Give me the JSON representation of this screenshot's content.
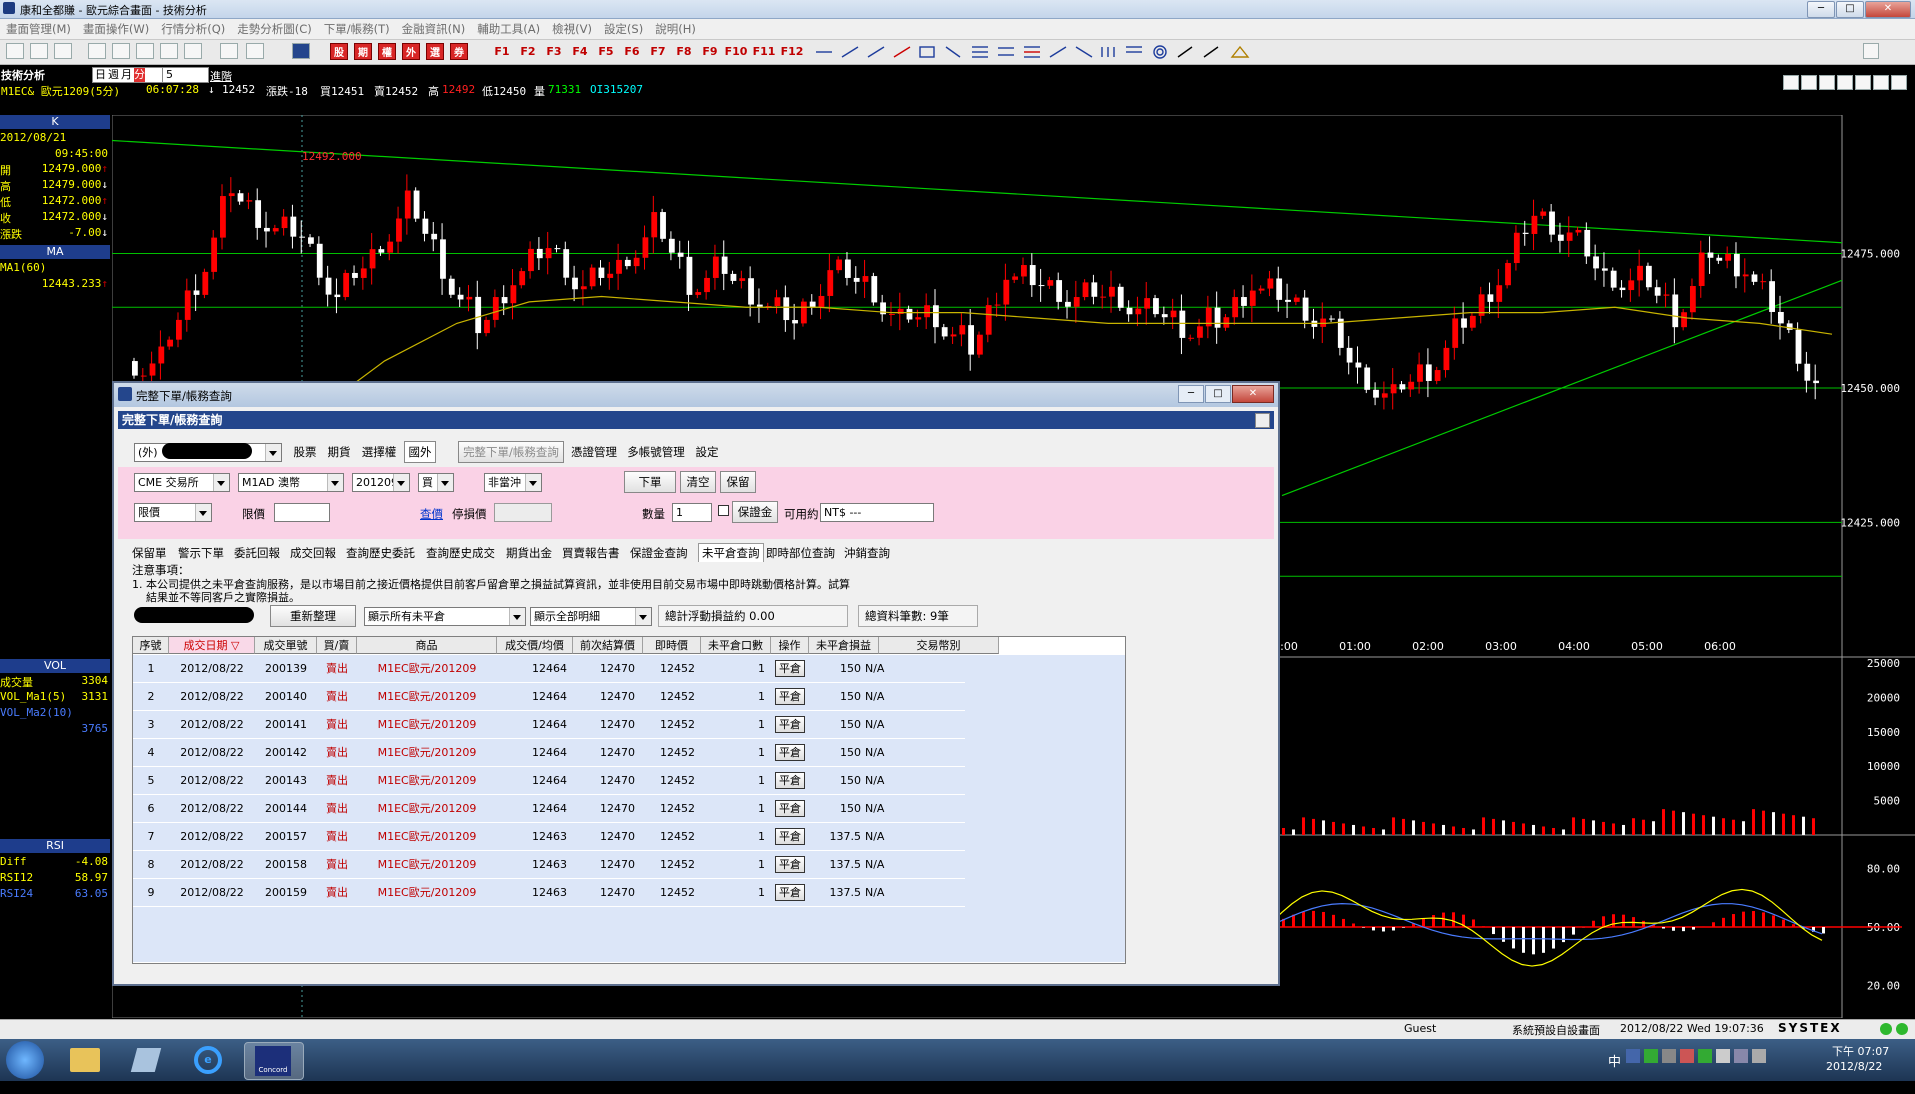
{
  "window": {
    "title": "康和全都賺 - 歐元綜合畫面 - 技術分析",
    "min": "─",
    "max": "□",
    "close": "✕"
  },
  "menu": [
    "畫面管理(M)",
    "畫面操作(W)",
    "行情分析(Q)",
    "走勢分析圖(C)",
    "下單/帳務(T)",
    "金融資訊(N)",
    "輔助工具(A)",
    "檢視(V)",
    "設定(S)",
    "說明(H)"
  ],
  "toolbar": {
    "red_buttons": [
      "股",
      "期",
      "權",
      "外",
      "選",
      "券"
    ],
    "fkeys": [
      "F1",
      "F2",
      "F3",
      "F4",
      "F5",
      "F6",
      "F7",
      "F8",
      "F9",
      "F10",
      "F11",
      "F12"
    ]
  },
  "chart_header": {
    "section": "技術分析",
    "period_options": [
      "日",
      "週",
      "月",
      "分"
    ],
    "period_selected": "分",
    "interval": "5",
    "advanced": "進階",
    "symbol": "M1EC& 歐元1209(5分)",
    "time": "06:07:28",
    "arrow": "↓",
    "last": "12452",
    "change": "漲跌-18",
    "bid": "買12451",
    "ask": "賣12452",
    "high_label": "高",
    "high": "12492",
    "low": "低12450",
    "volume_label": "量",
    "volume": "71331",
    "oi": "OI315207"
  },
  "left_panel": {
    "k_title": "K",
    "date": "2012/08/21",
    "time": "09:45:00",
    "rows": [
      {
        "k": "開",
        "v": "12479.000",
        "a": "↑"
      },
      {
        "k": "高",
        "v": "12479.000",
        "a": "↓"
      },
      {
        "k": "低",
        "v": "12472.000",
        "a": "↑"
      },
      {
        "k": "收",
        "v": "12472.000",
        "a": "↓"
      },
      {
        "k": "漲跌",
        "v": "-7.00",
        "a": "↓"
      }
    ],
    "ma_title": "MA",
    "ma_label": "MA1(60)",
    "ma_value": "12443.233",
    "ma_arrow": "↑",
    "vol_title": "VOL",
    "vol_rows": [
      {
        "k": "成交量",
        "v": "3304"
      },
      {
        "k": "VOL_Ma1(5)",
        "v": "3131"
      },
      {
        "k": "VOL_Ma2(10)",
        "v": ""
      }
    ],
    "vol_extra": "3765",
    "rsi_title": "RSI",
    "rsi_rows": [
      {
        "k": "Diff",
        "v": "-4.08"
      },
      {
        "k": "RSI12",
        "v": "58.97"
      },
      {
        "k": "RSI24",
        "v": "63.05"
      }
    ]
  },
  "chart_data": {
    "type": "line",
    "title": "",
    "ylim": [
      12400,
      12500
    ],
    "price_ticks": [
      "12475.000",
      "12450.000",
      "12425.000"
    ],
    "high_marker": "12492.000",
    "time_ticks": [
      "00:00",
      "01:00",
      "02:00",
      "03:00",
      "04:00",
      "05:00",
      "06:00"
    ],
    "volume_ticks": [
      "25000",
      "20000",
      "15000",
      "10000",
      "5000"
    ],
    "rsi_ticks": [
      "80.00",
      "50.00",
      "20.00"
    ],
    "ma_series": [
      12445,
      12455,
      12462,
      12466,
      12467,
      12466,
      12465,
      12465,
      12464,
      12464,
      12463,
      12462,
      12462,
      12462,
      12462,
      12463,
      12464,
      12464,
      12465,
      12463,
      12462,
      12460
    ],
    "close_series": [
      12455,
      12470,
      12488,
      12480,
      12478,
      12466,
      12474,
      12484,
      12473,
      12462,
      12470,
      12476,
      12468,
      12472,
      12480,
      12470,
      12473,
      12466,
      12462,
      12471,
      12469,
      12462,
      12464,
      12458,
      12471,
      12469,
      12466,
      12467,
      12464,
      12462,
      12463,
      12469,
      12466,
      12462,
      12452,
      12448,
      12454,
      12463,
      12470,
      12482,
      12478,
      12470,
      12470,
      12464,
      12476,
      12472,
      12462,
      12450
    ],
    "colors": {
      "up": "#ff0000",
      "down": "#ffffff",
      "ma": "#c8b400",
      "trend": "#00cc00",
      "rsi_a": "#ffff00",
      "rsi_b": "#4a7cff",
      "zero": "#ff0000"
    }
  },
  "dialog": {
    "title": "完整下單/帳務查詢",
    "header": "完整下單/帳務查詢",
    "account_prefix": "(外)",
    "top_tabs": [
      "股票",
      "期貨",
      "選擇權",
      "國外",
      "完整下單/帳務查詢",
      "憑證管理",
      "多帳號管理",
      "設定"
    ],
    "exchange": "CME 交易所",
    "product": "M1AD  澳幣",
    "month": "201209",
    "side": "買",
    "offset": "非當沖",
    "btn_order": "下單",
    "btn_clear": "清空",
    "btn_keep": "保留",
    "price_type": "限價",
    "limit_label": "限價",
    "query_link": "查價",
    "stop_label": "停損價",
    "qty_label": "數量",
    "qty_value": "1",
    "margin_btn": "保證金",
    "avail_label": "可用約",
    "avail_value": "NT$ ---",
    "tabs": [
      "保留單",
      "警示下單",
      "委託回報",
      "成交回報",
      "查詢歷史委託",
      "查詢歷史成交",
      "期貨出金",
      "買賣報告書",
      "保證金查詢",
      "未平倉查詢",
      "即時部位查詢",
      "沖銷查詢"
    ],
    "notice_title": "注意事項：",
    "notice_1": "1. 本公司提供之未平倉查詢服務，是以市場目前之接近價格提供目前客戶留倉單之損益試算資訊，並非使用目前交易市場中即時跳動價格計算。試算",
    "notice_2": "結果並不等同客戶之實際損益。",
    "refresh_btn": "重新整理",
    "filter1": "顯示所有未平倉",
    "filter2": "顯示全部明細",
    "pnl_total": "總計浮動損益約 0.00",
    "count_total": "總資料筆數:  9筆",
    "columns": [
      "序號",
      "成交日期",
      "成交單號",
      "買/賣",
      "商品",
      "成交價/均價",
      "前次結算價",
      "即時價",
      "未平倉口數",
      "操作",
      "未平倉損益",
      "交易幣別"
    ],
    "rows": [
      {
        "no": "1",
        "date": "2012/08/22",
        "id": "200139",
        "side": "賣出",
        "prod": "M1EC歐元/201209",
        "price": "12464",
        "settle": "12470",
        "last": "12452",
        "qty": "1",
        "op": "平倉",
        "pnl": "150",
        "cur": "N/A"
      },
      {
        "no": "2",
        "date": "2012/08/22",
        "id": "200140",
        "side": "賣出",
        "prod": "M1EC歐元/201209",
        "price": "12464",
        "settle": "12470",
        "last": "12452",
        "qty": "1",
        "op": "平倉",
        "pnl": "150",
        "cur": "N/A"
      },
      {
        "no": "3",
        "date": "2012/08/22",
        "id": "200141",
        "side": "賣出",
        "prod": "M1EC歐元/201209",
        "price": "12464",
        "settle": "12470",
        "last": "12452",
        "qty": "1",
        "op": "平倉",
        "pnl": "150",
        "cur": "N/A"
      },
      {
        "no": "4",
        "date": "2012/08/22",
        "id": "200142",
        "side": "賣出",
        "prod": "M1EC歐元/201209",
        "price": "12464",
        "settle": "12470",
        "last": "12452",
        "qty": "1",
        "op": "平倉",
        "pnl": "150",
        "cur": "N/A"
      },
      {
        "no": "5",
        "date": "2012/08/22",
        "id": "200143",
        "side": "賣出",
        "prod": "M1EC歐元/201209",
        "price": "12464",
        "settle": "12470",
        "last": "12452",
        "qty": "1",
        "op": "平倉",
        "pnl": "150",
        "cur": "N/A"
      },
      {
        "no": "6",
        "date": "2012/08/22",
        "id": "200144",
        "side": "賣出",
        "prod": "M1EC歐元/201209",
        "price": "12464",
        "settle": "12470",
        "last": "12452",
        "qty": "1",
        "op": "平倉",
        "pnl": "150",
        "cur": "N/A"
      },
      {
        "no": "7",
        "date": "2012/08/22",
        "id": "200157",
        "side": "賣出",
        "prod": "M1EC歐元/201209",
        "price": "12463",
        "settle": "12470",
        "last": "12452",
        "qty": "1",
        "op": "平倉",
        "pnl": "137.5",
        "cur": "N/A"
      },
      {
        "no": "8",
        "date": "2012/08/22",
        "id": "200158",
        "side": "賣出",
        "prod": "M1EC歐元/201209",
        "price": "12463",
        "settle": "12470",
        "last": "12452",
        "qty": "1",
        "op": "平倉",
        "pnl": "137.5",
        "cur": "N/A"
      },
      {
        "no": "9",
        "date": "2012/08/22",
        "id": "200159",
        "side": "賣出",
        "prod": "M1EC歐元/201209",
        "price": "12463",
        "settle": "12470",
        "last": "12452",
        "qty": "1",
        "op": "平倉",
        "pnl": "137.5",
        "cur": "N/A"
      }
    ]
  },
  "status": {
    "user": "Guest",
    "layout": "系統預設自設畫面",
    "datetime": "2012/08/22 Wed 19:07:36",
    "brand": "SYSTEX"
  },
  "taskbar": {
    "time": "下午 07:07",
    "date": "2012/8/22",
    "ime": "中",
    "concord": "Concord"
  }
}
